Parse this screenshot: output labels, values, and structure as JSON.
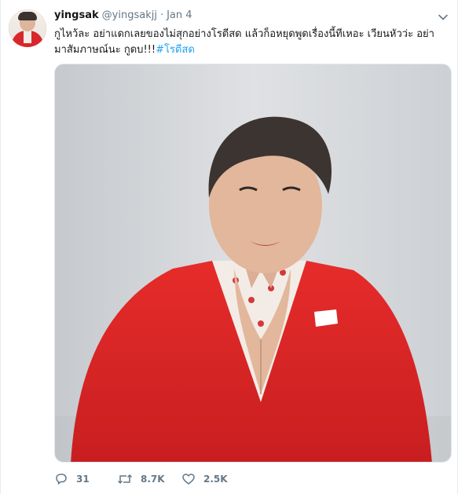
{
  "tweet": {
    "display_name": "yingsak",
    "handle": "@yingsakjj",
    "separator": "·",
    "date": "Jan 4",
    "text_line1": "กูไหว้ละ อย่าแดกเลยของไม่สุกอย่างโรตีสด แล้วก็อหยุดพูดเรื่องนี้ทีเหอะ เวียนหัวว่ะ อย่า",
    "text_line2_prefix": "มาสัมภาษณ์นะ กูดบ!!!",
    "hashtag": "#โรตีสด"
  },
  "actions": {
    "reply_count": "31",
    "retweet_count": "8.7K",
    "like_count": "2.5K"
  },
  "colors": {
    "link": "#1da1f2",
    "muted": "#657786",
    "suit_red": "#d8262d"
  },
  "icons": {
    "more": "chevron-down-icon",
    "reply": "reply-icon",
    "retweet": "retweet-icon",
    "like": "heart-icon"
  }
}
